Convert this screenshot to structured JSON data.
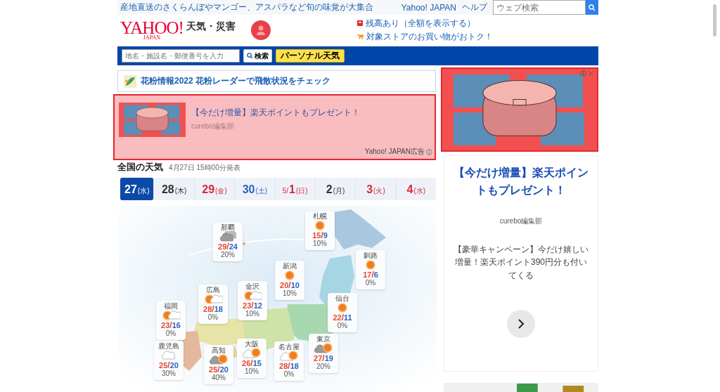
{
  "top_bar": {
    "promo": "産地直送のさくらんぼやマンゴー、アスパラなど旬の味覚が大集合",
    "links": [
      "Yahoo! JAPAN",
      "ヘルプ"
    ],
    "search": {
      "placeholder": "ウェブ検索"
    }
  },
  "header": {
    "logo": "YAHOO!",
    "logo_sub": "JAPAN",
    "service": "天気・災害",
    "notices": [
      {
        "kind": "card",
        "text": "残高あり（全額を表示する）"
      },
      {
        "kind": "cart",
        "text": "対象ストアのお買い物がおトク！"
      }
    ]
  },
  "search_bar": {
    "placeholder": "地名・施設名・郵便番号を入力",
    "button": "検索",
    "personal": "パーソナル天気"
  },
  "pollen_banner": {
    "text": "花粉情報2022 花粉レーダーで飛散状況をチェック"
  },
  "ad": {
    "title": "【今だけ増量】楽天ポイントもプレゼント！",
    "source": "curebo編集部",
    "label": "Yahoo! JAPAN広告"
  },
  "national": {
    "title": "全国の天気",
    "issued": "4月27日 15時00分発表"
  },
  "days": [
    {
      "day": "27",
      "weekday": "(水)",
      "selected": true
    },
    {
      "day": "28",
      "weekday": "(木)",
      "color": "#333333",
      "selected": false
    },
    {
      "day": "29",
      "weekday": "(金)",
      "color": "#d8283c",
      "selected": false
    },
    {
      "day": "30",
      "weekday": "(土)",
      "color": "#2a64c0",
      "selected": false
    },
    {
      "month": "5/",
      "day": "1",
      "weekday": "(日)",
      "color": "#d8283c",
      "selected": false
    },
    {
      "day": "2",
      "weekday": "(月)",
      "color": "#333333",
      "selected": false
    },
    {
      "day": "3",
      "weekday": "(火)",
      "color": "#d8283c",
      "selected": false
    },
    {
      "day": "4",
      "weekday": "(水)",
      "color": "#d8283c",
      "selected": false
    }
  ],
  "cities": [
    {
      "name": "那覇",
      "kind": "overcast",
      "high": "29",
      "sep": "/",
      "low": "24",
      "rain": "20%"
    },
    {
      "name": "札幌",
      "kind": "sun",
      "high": "15",
      "sep": "/",
      "low": "9",
      "rain": "10%"
    },
    {
      "name": "釧路",
      "kind": "sun",
      "high": "17",
      "sep": "/",
      "low": "6",
      "rain": "0%"
    },
    {
      "name": "新潟",
      "kind": "sun",
      "high": "20",
      "sep": "/",
      "low": "10",
      "rain": "10%"
    },
    {
      "name": "広島",
      "kind": "sun-cloud",
      "high": "28",
      "sep": "/",
      "low": "18",
      "rain": "0%"
    },
    {
      "name": "金沢",
      "kind": "sun-cloud",
      "high": "23",
      "sep": "/",
      "low": "12",
      "rain": "10%"
    },
    {
      "name": "仙台",
      "kind": "sun",
      "high": "22",
      "sep": "/",
      "low": "11",
      "rain": "0%"
    },
    {
      "name": "福岡",
      "kind": "sun-cloud",
      "high": "23",
      "sep": "/",
      "low": "16",
      "rain": "0%"
    },
    {
      "name": "東京",
      "kind": "overcast-sun",
      "high": "27",
      "sep": "/",
      "low": "19",
      "rain": "20%"
    },
    {
      "name": "鹿児島",
      "kind": "cloud",
      "high": "25",
      "sep": "/",
      "low": "20",
      "rain": "30%"
    },
    {
      "name": "高知",
      "kind": "overcast-sun",
      "high": "25",
      "sep": "/",
      "low": "20",
      "rain": "40%"
    },
    {
      "name": "大阪",
      "kind": "cloud-sun",
      "high": "26",
      "sep": "/",
      "low": "15",
      "rain": "10%"
    },
    {
      "name": "名古屋",
      "kind": "cloud-sun",
      "high": "28",
      "sep": "/",
      "low": "18",
      "rain": "0%"
    }
  ],
  "side_ad": {
    "title": "【今だけ増量】楽天ポイントもプレゼント！",
    "source": "curebo編集部",
    "description": "【豪華キャンペーン】今だけ嬉しい増量！楽天ポイント390円分も付いてくる"
  }
}
